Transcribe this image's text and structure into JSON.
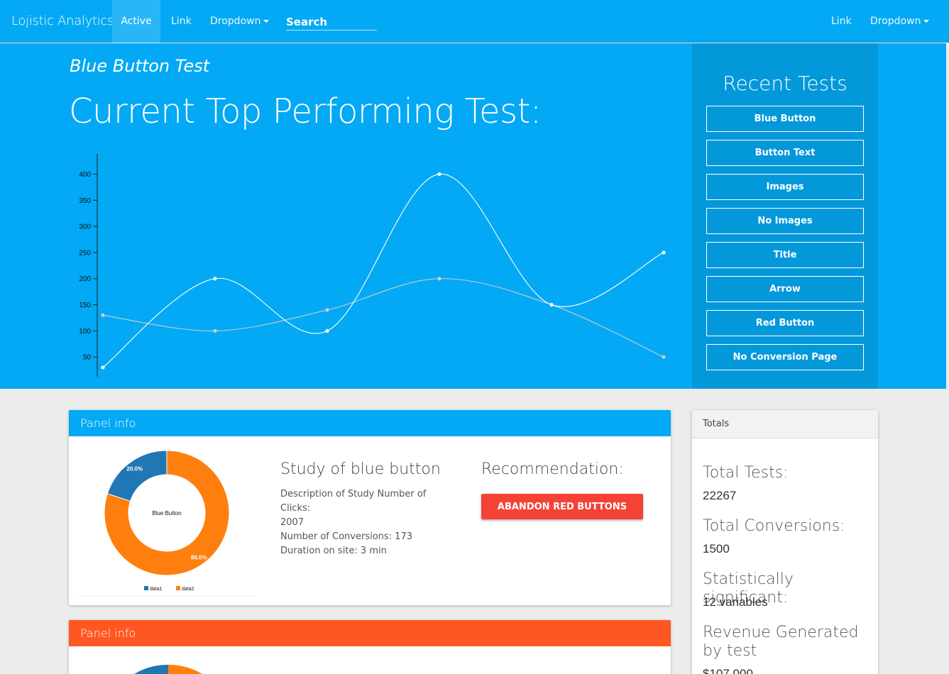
{
  "navbar": {
    "brand": "Lojistic Analytics",
    "left_items": [
      "Active",
      "Link",
      "Dropdown"
    ],
    "search_placeholder": "Search",
    "right_items": [
      "Link",
      "Dropdown"
    ]
  },
  "hero": {
    "subtitle": "Blue Button Test",
    "title": "Current Top Performing Test:"
  },
  "recent_tests": {
    "title": "Recent Tests",
    "items": [
      "Blue Button",
      "Button Text",
      "Images",
      "No Images",
      "Title",
      "Arrow",
      "Red Button",
      "No Conversion Page"
    ]
  },
  "panels": [
    {
      "heading": "Panel info",
      "heading_color": "#03a9f4",
      "study_title": "Study of blue button",
      "desc_line1": "Description of Study Number of Clicks:",
      "desc_line2": "2007",
      "desc_line3": "Number of Conversions: 173",
      "desc_line4": "Duration on site: 3 min",
      "recommendation_title": "Recommendation:",
      "recommendation_button": "ABANDON RED BUTTONS"
    },
    {
      "heading": "Panel info",
      "heading_color": "#ff5722"
    }
  ],
  "totals": {
    "heading": "Totals",
    "total_tests_label": "Total Tests:",
    "total_tests_value": "22267",
    "total_conversions_label": "Total Conversions:",
    "total_conversions_value": "1500",
    "significant_label": "Statistically significant:",
    "significant_value": "12 variables",
    "revenue_label": "Revenue Generated by test",
    "revenue_value": "$107,000"
  },
  "chart_data": [
    {
      "type": "line",
      "smooth": true,
      "x": [
        0,
        1,
        2,
        3,
        4,
        5
      ],
      "series": [
        {
          "name": "data1",
          "values": [
            30,
            200,
            100,
            400,
            150,
            250
          ],
          "color": "#ffffff"
        },
        {
          "name": "data2",
          "values": [
            130,
            100,
            140,
            200,
            150,
            50
          ],
          "color": "#cccccc"
        }
      ],
      "ylim": [
        0,
        440
      ],
      "yticks": [
        0,
        50,
        100,
        150,
        200,
        250,
        300,
        350,
        400
      ],
      "legend": "bottom"
    },
    {
      "type": "pie",
      "donut": true,
      "center_label": "Blue Button",
      "series": [
        {
          "name": "data1",
          "value": 20,
          "label": "20.0%",
          "color": "#1f77b4"
        },
        {
          "name": "data2",
          "value": 80,
          "label": "80.0%",
          "color": "#ff7f0e"
        }
      ],
      "legend": "bottom"
    }
  ]
}
